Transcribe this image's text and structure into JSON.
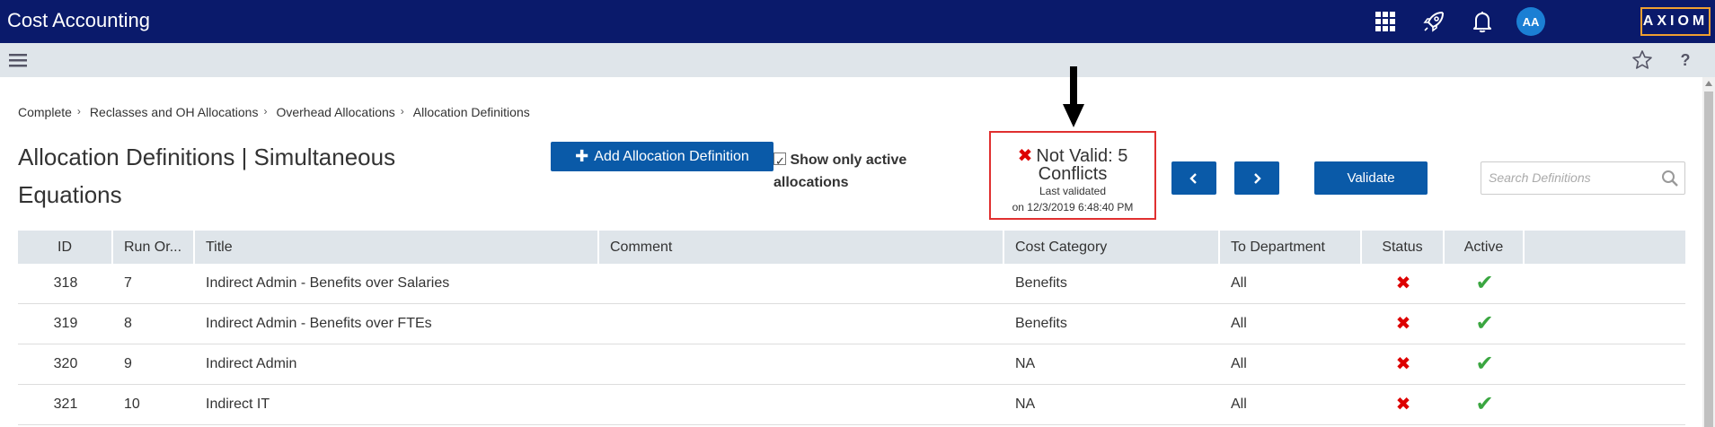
{
  "app": {
    "title": "Cost Accounting",
    "brand": "AXIOM",
    "avatar_initials": "AA"
  },
  "icons": {
    "apps": "grid-icon",
    "launch": "rocket-icon",
    "notifications": "bell-icon",
    "menu": "menu-icon",
    "favorite": "star-icon",
    "help": "help-icon",
    "search": "search-icon",
    "prev": "chevron-left-icon",
    "next": "chevron-right-icon",
    "add": "plus-icon",
    "status_invalid": "x-icon",
    "active_yes": "checkmark-icon"
  },
  "breadcrumb": [
    "Complete",
    "Reclasses and OH Allocations",
    "Overhead Allocations",
    "Allocation Definitions"
  ],
  "page": {
    "title": "Allocation Definitions | Simultaneous Equations",
    "add_button_label": "Add Allocation Definition",
    "active_toggle_label": "Show only active allocations",
    "active_toggle_checked": true,
    "validate_label": "Validate",
    "search_placeholder": "Search Definitions"
  },
  "validation": {
    "status": "Not Valid: 5 Conflicts",
    "last_validated_label": "Last validated",
    "last_validated_on": "on 12/3/2019 6:48:40 PM"
  },
  "table": {
    "columns": [
      "ID",
      "Run Or...",
      "Title",
      "Comment",
      "Cost Category",
      "To Department",
      "Status",
      "Active"
    ],
    "rows": [
      {
        "id": "318",
        "run_order": "7",
        "title": "Indirect Admin - Benefits over Salaries",
        "comment": "",
        "cost_category": "Benefits",
        "to_department": "All",
        "status": "invalid",
        "active": true
      },
      {
        "id": "319",
        "run_order": "8",
        "title": "Indirect Admin - Benefits over FTEs",
        "comment": "",
        "cost_category": "Benefits",
        "to_department": "All",
        "status": "invalid",
        "active": true
      },
      {
        "id": "320",
        "run_order": "9",
        "title": "Indirect Admin",
        "comment": "",
        "cost_category": "NA",
        "to_department": "All",
        "status": "invalid",
        "active": true
      },
      {
        "id": "321",
        "run_order": "10",
        "title": "Indirect IT",
        "comment": "",
        "cost_category": "NA",
        "to_department": "All",
        "status": "invalid",
        "active": true
      }
    ]
  },
  "colors": {
    "topbar": "#0a1a6b",
    "subbar": "#dfe5ea",
    "primary_button": "#0a5aa8",
    "brand_border": "#f0a030",
    "invalid": "#dd0000",
    "valid": "#3aa640",
    "highlight_box": "#e03030"
  }
}
